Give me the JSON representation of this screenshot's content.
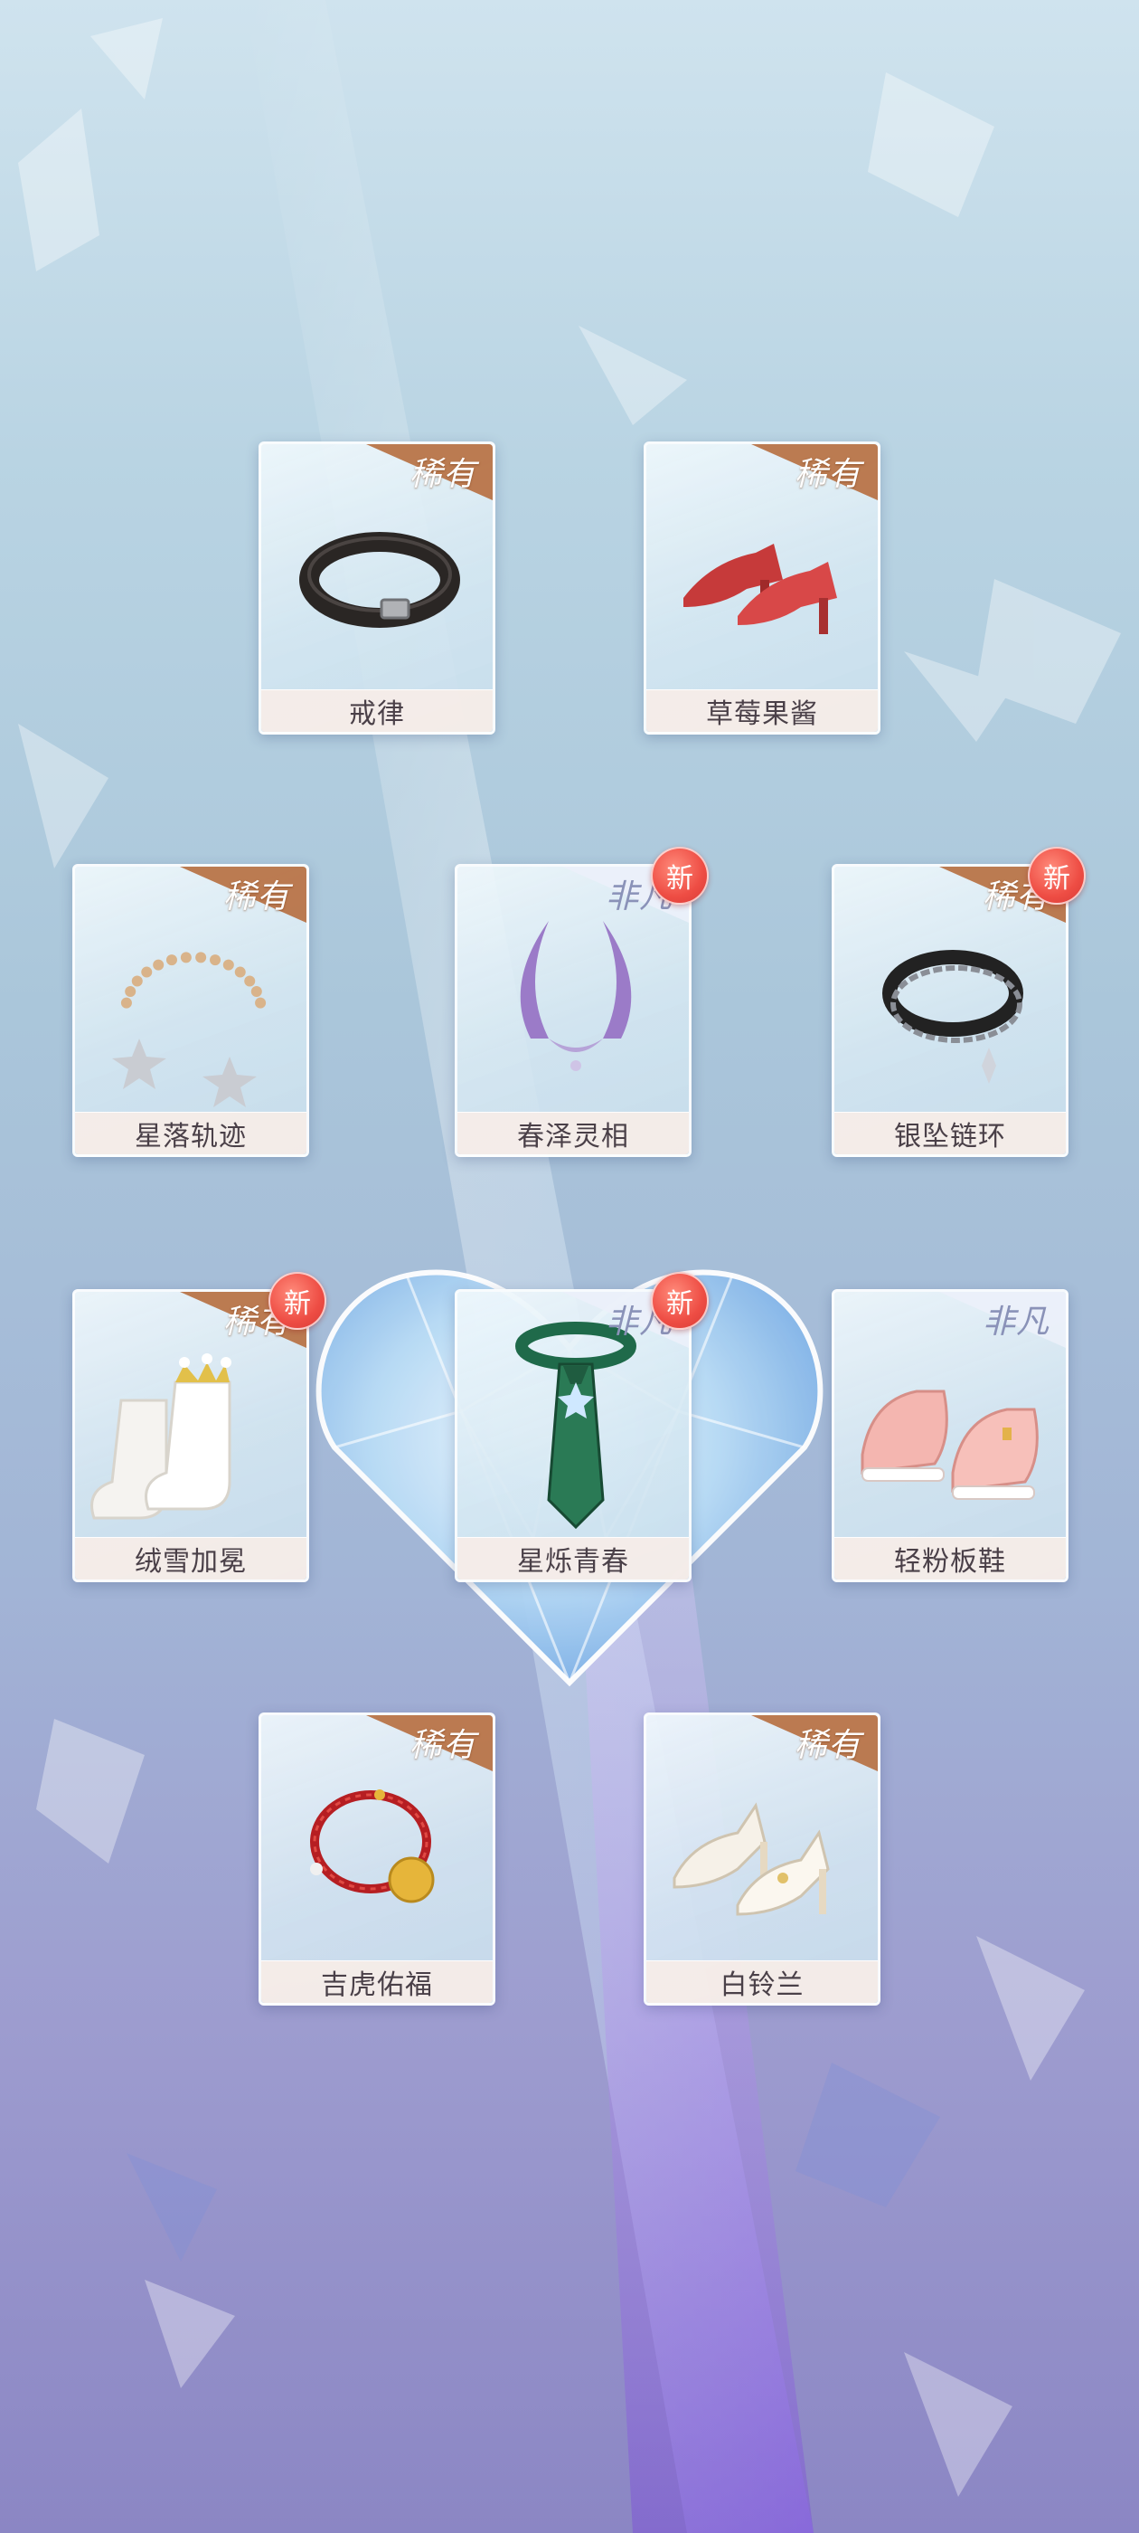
{
  "items": [
    {
      "name": "戒律",
      "rarity": "稀有",
      "new": false,
      "icon": "belt-icon"
    },
    {
      "name": "草莓果酱",
      "rarity": "稀有",
      "new": false,
      "icon": "red-heels-icon"
    },
    {
      "name": "星落轨迹",
      "rarity": "稀有",
      "new": false,
      "icon": "star-necklace-icon"
    },
    {
      "name": "春泽灵相",
      "rarity": "非凡",
      "new": true,
      "new_label": "新",
      "icon": "horn-headpiece-icon"
    },
    {
      "name": "银坠链环",
      "rarity": "稀有",
      "new": true,
      "new_label": "新",
      "icon": "chain-bracelet-icon"
    },
    {
      "name": "绒雪加冕",
      "rarity": "稀有",
      "new": true,
      "new_label": "新",
      "icon": "crown-socks-icon"
    },
    {
      "name": "星烁青春",
      "rarity": "非凡",
      "new": true,
      "new_label": "新",
      "icon": "green-tie-icon"
    },
    {
      "name": "轻粉板鞋",
      "rarity": "非凡",
      "new": false,
      "icon": "pink-sneakers-icon"
    },
    {
      "name": "吉虎佑福",
      "rarity": "稀有",
      "new": false,
      "icon": "red-bracelet-icon"
    },
    {
      "name": "白铃兰",
      "rarity": "稀有",
      "new": false,
      "icon": "white-heels-icon"
    }
  ],
  "colors": {
    "rare": "#b87448",
    "epic": "#eceff9",
    "new_badge": "#ee4d44"
  }
}
